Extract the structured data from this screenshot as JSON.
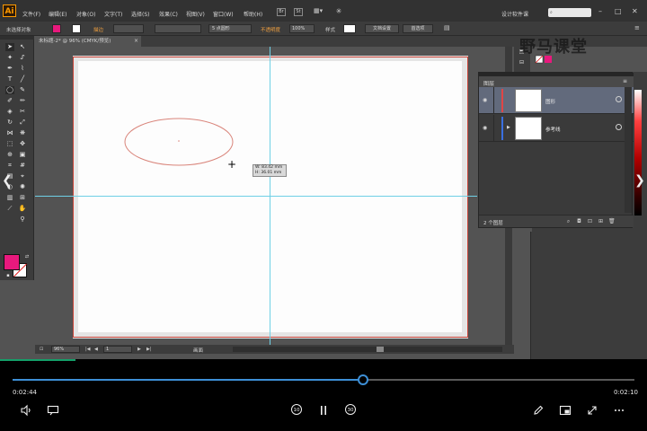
{
  "app": {
    "logo": "Ai",
    "menu": [
      "文件(F)",
      "编辑(E)",
      "对象(O)",
      "文字(T)",
      "选择(S)",
      "效果(C)",
      "视图(V)",
      "窗口(W)",
      "帮助(H)"
    ],
    "menubar_icons": [
      "Br",
      "St"
    ],
    "workspace": "设计软件课",
    "search_placeholder": "",
    "window_controls": [
      "–",
      "□",
      "✕"
    ]
  },
  "control_bar": {
    "selection_label": "未选择对象",
    "stroke_label": "描边",
    "brush_value": "5 点圆形",
    "opacity_label": "不透明度",
    "opacity_value": "100%",
    "style_label": "样式",
    "doc_setup_button": "文档设置",
    "preferences_button": "首选项"
  },
  "document": {
    "tab_title": "未标题-2* @ 96% (CMYK/预览)",
    "tab_close": "×",
    "tooltip_w": "W: 83.42 mm",
    "tooltip_h": "H: 36.01 mm",
    "crosshair": "+",
    "zoom": "96%",
    "page": "1",
    "status": "画面"
  },
  "layers_panel": {
    "title": "图层",
    "menu_icon": "≡",
    "layers": [
      {
        "name": "图形",
        "color": "#e04646",
        "selected": true
      },
      {
        "name": "参考线",
        "color": "#3a6fe0",
        "selected": false
      }
    ],
    "count": "2 个图层"
  },
  "colors": {
    "fill": "#e8197d",
    "stroke_shape": "#d9847a",
    "guide": "#6fd0e6",
    "bleed": "#c9453a",
    "accent": "#3d8fd6"
  },
  "watermark": "野马课堂",
  "player": {
    "current_time": "0:02:44",
    "total_time": "0:02:10",
    "progress": 0.564,
    "skip_back": "10",
    "skip_forward": "30"
  }
}
